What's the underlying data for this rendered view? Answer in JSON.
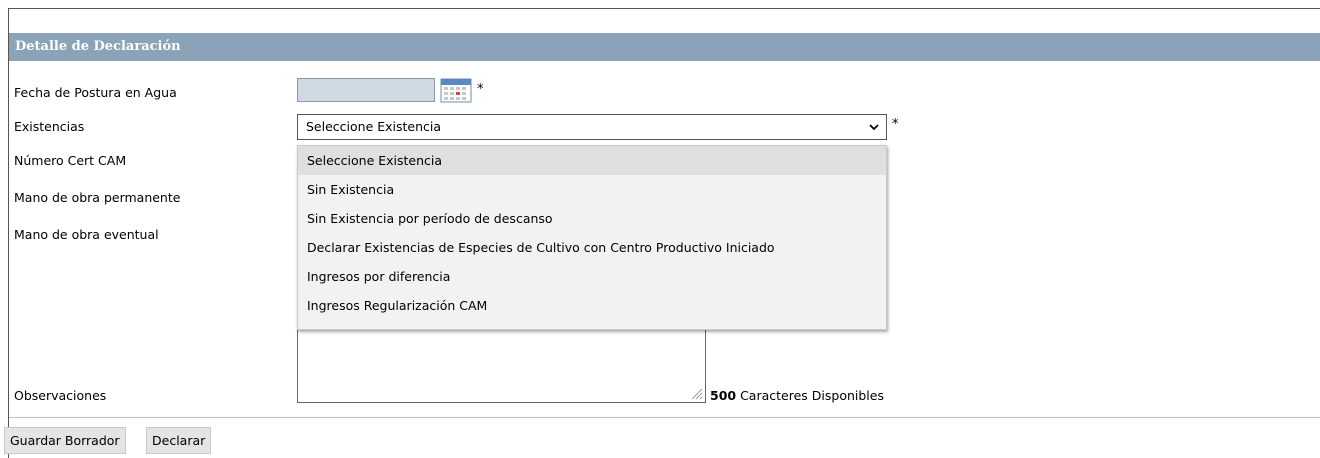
{
  "section": {
    "title": "Detalle de Declaración"
  },
  "form": {
    "fecha_label": "Fecha de Postura en Agua",
    "fecha_value": "",
    "existencias_label": "Existencias",
    "numero_cert_label": "Número Cert CAM",
    "mano_permanente_label": "Mano de obra permanente",
    "mano_eventual_label": "Mano de obra eventual",
    "observaciones_label": "Observaciones",
    "required_marker": "*"
  },
  "select": {
    "selected": "Seleccione Existencia",
    "options": [
      "Seleccione Existencia",
      "Sin Existencia",
      "Sin Existencia por período de descanso",
      "Declarar Existencias de Especies de Cultivo con Centro Productivo Iniciado",
      "Ingresos por diferencia",
      "Ingresos Regularización CAM"
    ]
  },
  "observaciones": {
    "remaining": "500",
    "remaining_suffix": "Caracteres Disponibles"
  },
  "buttons": {
    "guardar": "Guardar Borrador",
    "declarar": "Declarar"
  },
  "icons": {
    "calendar": "calendar-icon",
    "chevron": "chevron-down-icon",
    "resize": "resize-grip-icon"
  },
  "colors": {
    "header_bg": "#8aa3b8",
    "date_input_bg": "#cfd9e2",
    "dropdown_bg": "#f2f2f2",
    "dropdown_highlight": "#dfdfdf",
    "button_bg": "#e4e4e4"
  }
}
